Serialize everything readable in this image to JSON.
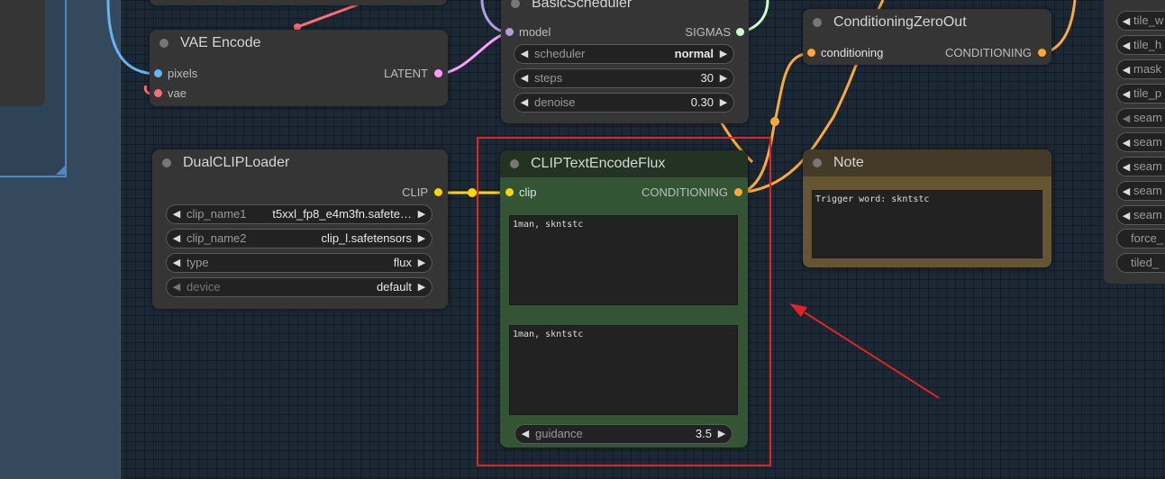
{
  "colors": {
    "canvas_bg": "#1b2836",
    "node_bg": "#353535",
    "clip_node_bg": "#335533",
    "clip_node_title": "#223322",
    "note_node_bg": "#665533",
    "note_node_title": "#433b28",
    "wire_latent": "#ff9cf9",
    "wire_clip": "#ffd500",
    "wire_conditioning": "#ffa931",
    "wire_image": "#64b5f6",
    "wire_vae": "#ff6e6e",
    "wire_sigmas": "#cdffcd",
    "wire_model": "#b39ddb",
    "annotation": "#e32222"
  },
  "nodes": {
    "vae_encode": {
      "title": "VAE Encode",
      "inputs": [
        "pixels",
        "vae"
      ],
      "output": "LATENT"
    },
    "basic_scheduler": {
      "title": "BasicScheduler",
      "input": "model",
      "output": "SIGMAS",
      "widgets": [
        {
          "label": "scheduler",
          "value": "normal"
        },
        {
          "label": "steps",
          "value": "30"
        },
        {
          "label": "denoise",
          "value": "0.30"
        }
      ]
    },
    "conditioning_zero_out": {
      "title": "ConditioningZeroOut",
      "input": "conditioning",
      "output": "CONDITIONING"
    },
    "dual_clip_loader": {
      "title": "DualCLIPLoader",
      "output": "CLIP",
      "widgets": [
        {
          "label": "clip_name1",
          "value": "t5xxl_fp8_e4m3fn.safete…"
        },
        {
          "label": "clip_name2",
          "value": "clip_l.safetensors"
        },
        {
          "label": "type",
          "value": "flux"
        },
        {
          "label": "device",
          "value": "default"
        }
      ]
    },
    "clip_text_encode_flux": {
      "title": "CLIPTextEncodeFlux",
      "input": "clip",
      "output": "CONDITIONING",
      "clip_l_text": "1man, skntstc",
      "t5xxl_text": "1man, skntstc",
      "guidance_label": "guidance",
      "guidance_value": "3.5"
    },
    "note": {
      "title": "Note",
      "text": "Trigger word: skntstc"
    }
  },
  "right_panel": {
    "items": [
      "tile_w",
      "tile_h",
      "mask",
      "tile_p",
      "seam",
      "seam",
      "seam",
      "seam",
      "seam",
      "force_",
      "tiled_"
    ]
  }
}
